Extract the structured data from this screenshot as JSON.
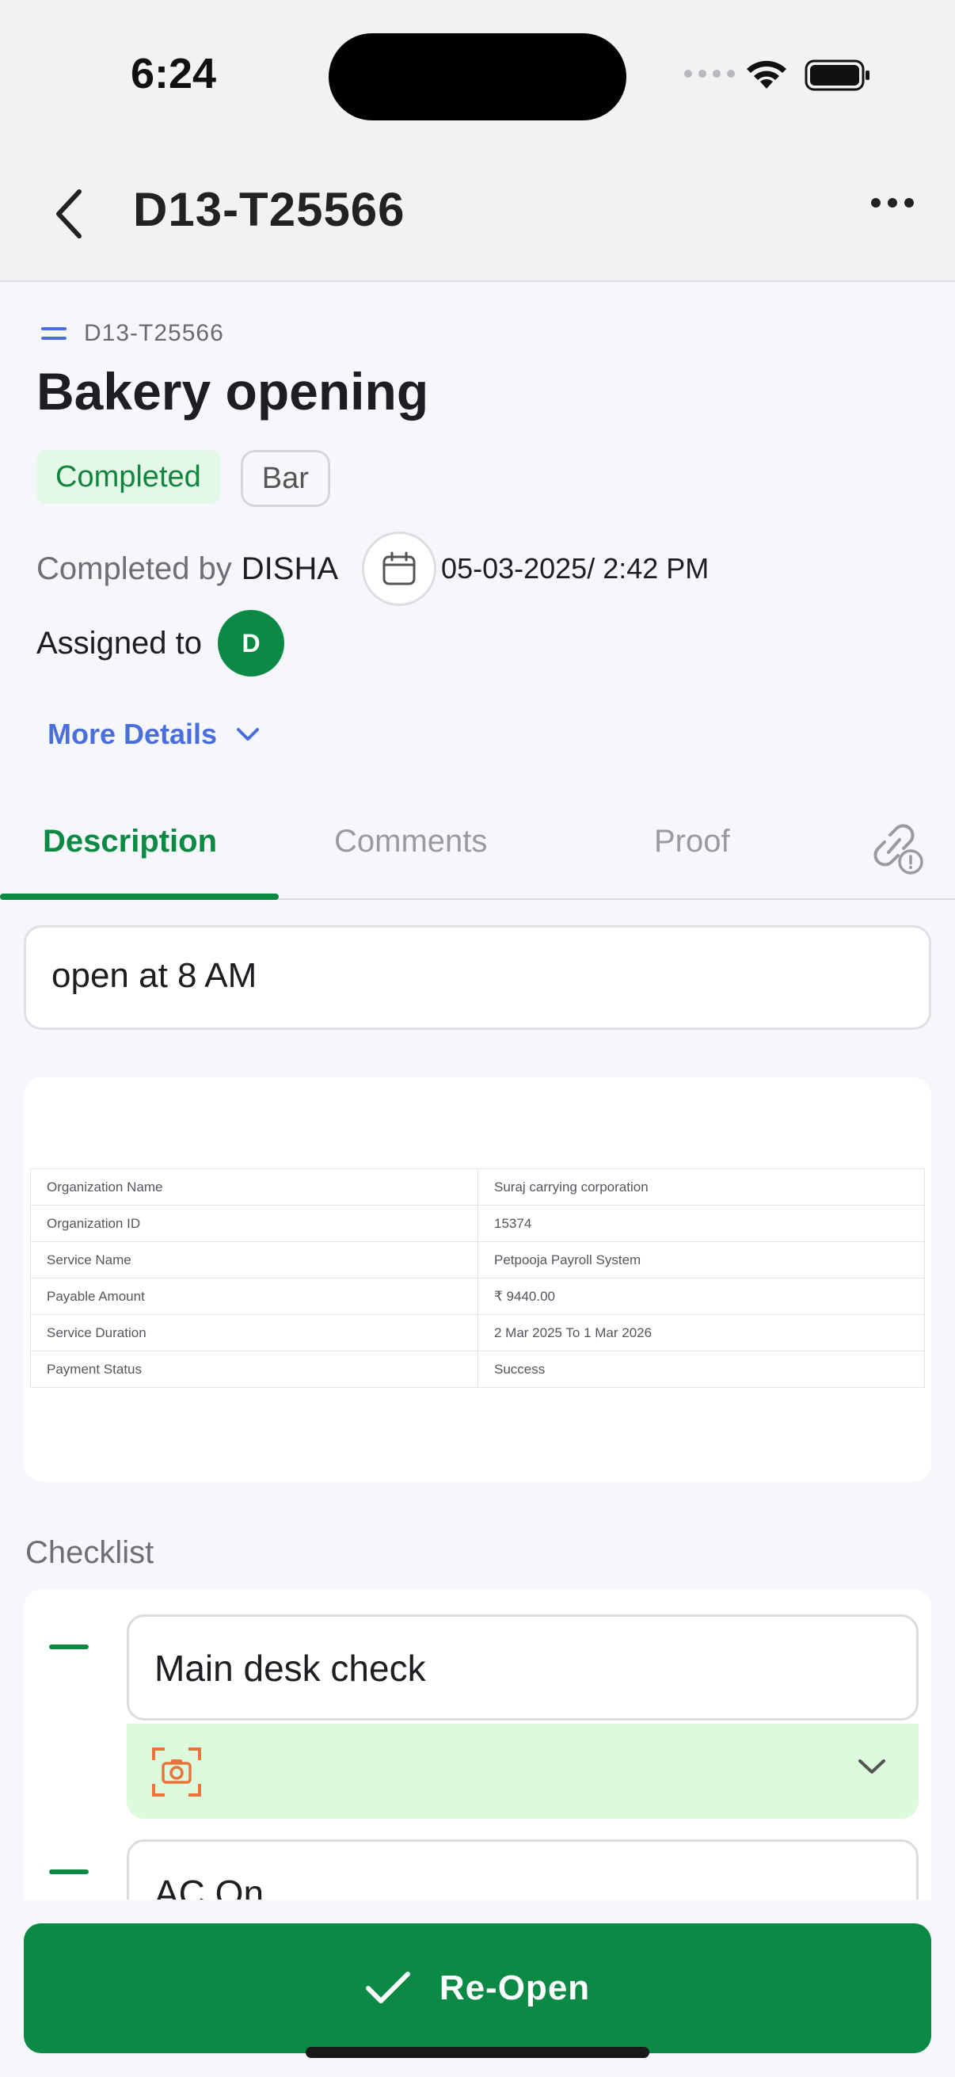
{
  "status_bar": {
    "time": "6:24"
  },
  "header": {
    "title": "D13-T25566"
  },
  "task": {
    "id": "D13-T25566",
    "title": "Bakery opening",
    "status": "Completed",
    "tag": "Bar",
    "completed_by_label": "Completed by",
    "completed_by": "DISHA",
    "completed_at": "05-03-2025/ 2:42 PM",
    "assigned_to_label": "Assigned to",
    "assignee_initial": "D",
    "more_details": "More Details"
  },
  "tabs": [
    {
      "label": "Description",
      "active": true
    },
    {
      "label": "Comments",
      "active": false
    },
    {
      "label": "Proof",
      "active": false
    }
  ],
  "description": "open at 8 AM",
  "attachment_table": [
    [
      "Organization Name",
      "Suraj carrying corporation"
    ],
    [
      "Organization ID",
      "15374"
    ],
    [
      "Service Name",
      "Petpooja Payroll System"
    ],
    [
      "Payable Amount",
      "₹ 9440.00"
    ],
    [
      "Service Duration",
      "2 Mar 2025  To  1 Mar 2026"
    ],
    [
      "Payment Status",
      "Success"
    ]
  ],
  "checklist": {
    "label": "Checklist",
    "items": [
      {
        "label": "Main desk check"
      },
      {
        "label": "AC On"
      }
    ]
  },
  "footer": {
    "reopen_label": "Re-Open"
  },
  "colors": {
    "accent_green": "#0a8a44",
    "link_blue": "#4a6fdc",
    "status_chip_bg": "#e3f8e6",
    "proof_bg": "#dcfbdd",
    "camera_orange": "#e8743b"
  }
}
